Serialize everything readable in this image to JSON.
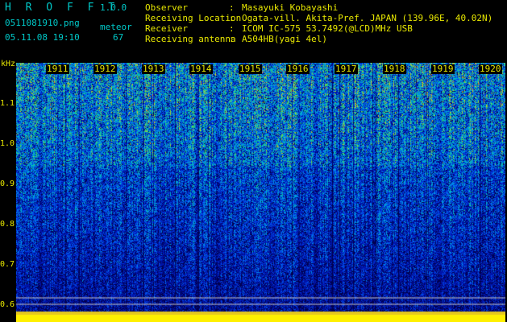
{
  "app": {
    "title": "H R O F F T",
    "version": "1.0.0"
  },
  "file": {
    "name": "0511081910.png",
    "datetime": "05.11.08 19:10",
    "type": "meteor",
    "count": "67"
  },
  "info": [
    {
      "label": "Observer",
      "value": "Masayuki Kobayashi"
    },
    {
      "label": "Receiving Location",
      "value": "Ogata-vill. Akita-Pref. JAPAN (139.96E, 40.02N)"
    },
    {
      "label": "Receiver",
      "value": "ICOM IC-575 53.7492(@LCD)MHz USB"
    },
    {
      "label": "Receiving antenna",
      "value": "A504HB(yagi 4el)"
    }
  ],
  "separator": ":",
  "axis": {
    "unit": "kHz",
    "y_ticks": [
      "1.1",
      "1.0",
      "0.9",
      "0.8",
      "0.7",
      "0.6"
    ],
    "x_ticks": [
      "1911",
      "1912",
      "1913",
      "1914",
      "1915",
      "1916",
      "1917",
      "1918",
      "1919",
      "1920"
    ]
  },
  "colors": {
    "label": "#e8e800",
    "title": "#00c8c8"
  }
}
